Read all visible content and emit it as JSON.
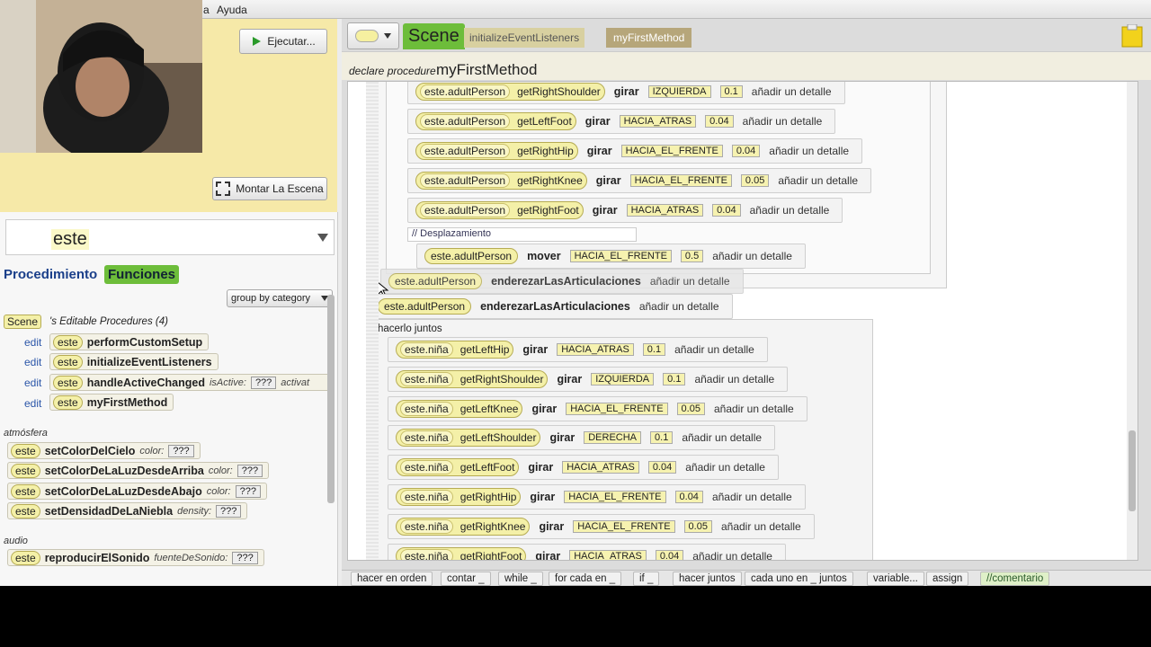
{
  "menu": {
    "items": [
      "a",
      "Ayuda"
    ]
  },
  "scene_panel": {
    "run_label": "Ejecutar...",
    "setup_label": "Montar La Escena"
  },
  "left_panel": {
    "search_value": "este",
    "tabs": [
      "Procedimiento",
      "Funciones"
    ],
    "group_label": "group by category",
    "scene_label": "Scene",
    "procs_header": "'s Editable Procedures (4)",
    "edit_label": "edit",
    "procs": [
      {
        "este": "este",
        "name": "performCustomSetup"
      },
      {
        "este": "este",
        "name": "initializeEventListeners"
      },
      {
        "este": "este",
        "name": "handleActiveChanged",
        "p1": "isActive:",
        "q": "???",
        "p2": "activat"
      },
      {
        "este": "este",
        "name": "myFirstMethod"
      }
    ],
    "cat_atmosfera": "atmósfera",
    "atmos": [
      {
        "este": "este",
        "name": "setColorDelCielo",
        "param": "color:",
        "q": "???"
      },
      {
        "este": "este",
        "name": "setColorDeLaLuzDesdeArriba",
        "param": "color:",
        "q": "???"
      },
      {
        "este": "este",
        "name": "setColorDeLaLuzDesdeAbajo",
        "param": "color:",
        "q": "???"
      },
      {
        "este": "este",
        "name": "setDensidadDeLaNiebla",
        "param": "density:",
        "q": "???"
      }
    ],
    "cat_audio": "audio",
    "audio": [
      {
        "este": "este",
        "name": "reproducirElSonido",
        "param": "fuenteDeSonido:",
        "q": "???"
      }
    ]
  },
  "editor": {
    "tabs": [
      "Scene",
      "initializeEventListeners",
      "myFirstMethod"
    ],
    "declare": "declare procedure",
    "method": "myFirstMethod",
    "comment": "// Desplazamiento",
    "do_together": "hacerlo juntos",
    "adult_rows": [
      {
        "obj": "este.adultPerson",
        "getter": "getRightShoulder",
        "verb": "girar",
        "dir": "IZQUIERDA",
        "amt": "0.1",
        "det": "añadir un detalle"
      },
      {
        "obj": "este.adultPerson",
        "getter": "getLeftFoot",
        "verb": "girar",
        "dir": "HACIA_ATRAS",
        "amt": "0.04",
        "det": "añadir un detalle"
      },
      {
        "obj": "este.adultPerson",
        "getter": "getRightHip",
        "verb": "girar",
        "dir": "HACIA_EL_FRENTE",
        "amt": "0.04",
        "det": "añadir un detalle"
      },
      {
        "obj": "este.adultPerson",
        "getter": "getRightKnee",
        "verb": "girar",
        "dir": "HACIA_EL_FRENTE",
        "amt": "0.05",
        "det": "añadir un detalle"
      },
      {
        "obj": "este.adultPerson",
        "getter": "getRightFoot",
        "verb": "girar",
        "dir": "HACIA_ATRAS",
        "amt": "0.04",
        "det": "añadir un detalle"
      }
    ],
    "move_row": {
      "obj": "este.adultPerson",
      "verb": "mover",
      "dir": "HACIA_EL_FRENTE",
      "amt": "0.5",
      "det": "añadir un detalle"
    },
    "straighten_rows": [
      {
        "obj": "este.adultPerson",
        "verb": "enderezarLasArticulaciones",
        "det": "añadir un detalle"
      },
      {
        "obj": "este.adultPerson",
        "verb": "enderezarLasArticulaciones",
        "det": "añadir un detalle"
      }
    ],
    "nina_rows": [
      {
        "obj": "este.niña",
        "getter": "getLeftHip",
        "verb": "girar",
        "dir": "HACIA_ATRAS",
        "amt": "0.1",
        "det": "añadir un detalle"
      },
      {
        "obj": "este.niña",
        "getter": "getRightShoulder",
        "verb": "girar",
        "dir": "IZQUIERDA",
        "amt": "0.1",
        "det": "añadir un detalle"
      },
      {
        "obj": "este.niña",
        "getter": "getLeftKnee",
        "verb": "girar",
        "dir": "HACIA_EL_FRENTE",
        "amt": "0.05",
        "det": "añadir un detalle"
      },
      {
        "obj": "este.niña",
        "getter": "getLeftShoulder",
        "verb": "girar",
        "dir": "DERECHA",
        "amt": "0.1",
        "det": "añadir un detalle"
      },
      {
        "obj": "este.niña",
        "getter": "getLeftFoot",
        "verb": "girar",
        "dir": "HACIA_ATRAS",
        "amt": "0.04",
        "det": "añadir un detalle"
      },
      {
        "obj": "este.niña",
        "getter": "getRightHip",
        "verb": "girar",
        "dir": "HACIA_EL_FRENTE",
        "amt": "0.04",
        "det": "añadir un detalle"
      },
      {
        "obj": "este.niña",
        "getter": "getRightKnee",
        "verb": "girar",
        "dir": "HACIA_EL_FRENTE",
        "amt": "0.05",
        "det": "añadir un detalle"
      },
      {
        "obj": "este.niña",
        "getter": "getRightFoot",
        "verb": "girar",
        "dir": "HACIA_ATRAS",
        "amt": "0.04",
        "det": "añadir un detalle"
      }
    ]
  },
  "bottom_controls": [
    "hacer en orden",
    "contar _",
    "while _",
    "for cada en _",
    "if _",
    "hacer juntos",
    "cada uno en _ juntos",
    "variable...",
    "assign",
    "//comentario"
  ]
}
